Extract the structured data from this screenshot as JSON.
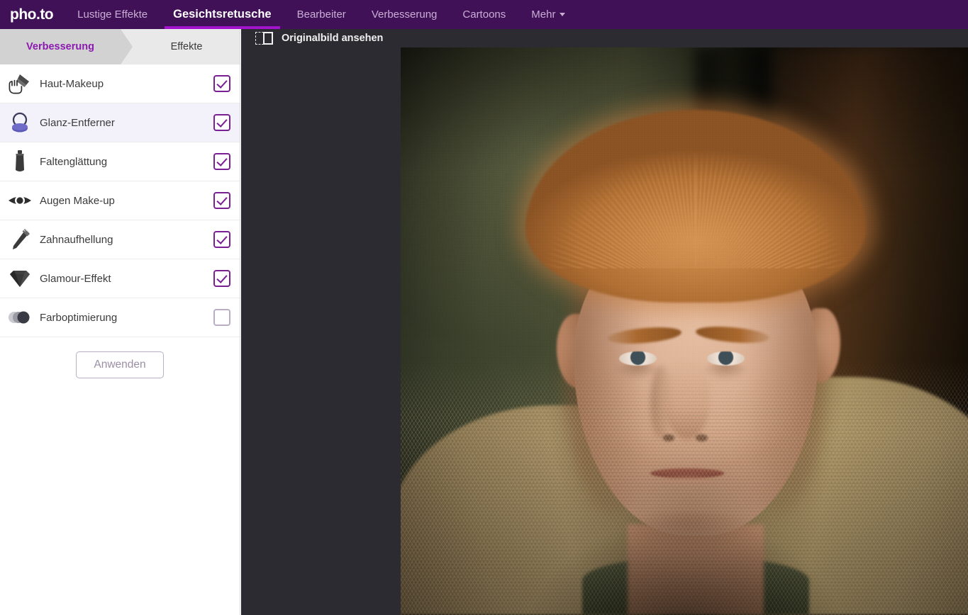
{
  "topnav": {
    "logo": "pho.to",
    "links": [
      {
        "label": "Lustige Effekte",
        "active": false
      },
      {
        "label": "Gesichtsretusche",
        "active": true
      },
      {
        "label": "Bearbeiter",
        "active": false
      },
      {
        "label": "Verbesserung",
        "active": false
      },
      {
        "label": "Cartoons",
        "active": false
      },
      {
        "label": "Mehr",
        "active": false,
        "has_caret": true
      }
    ],
    "background_color": "#411158",
    "accent_color": "#a114cc"
  },
  "sidebar": {
    "tabs": [
      {
        "label": "Verbesserung",
        "active": true
      },
      {
        "label": "Effekte",
        "active": false
      }
    ],
    "options": [
      {
        "label": "Haut-Makeup",
        "icon": "makeup-brush-icon",
        "checked": true,
        "highlighted": false,
        "cursor": true
      },
      {
        "label": "Glanz-Entferner",
        "icon": "powder-puff-icon",
        "checked": true,
        "highlighted": true,
        "cursor": false
      },
      {
        "label": "Faltenglättung",
        "icon": "cream-tube-icon",
        "checked": true,
        "highlighted": false,
        "cursor": false
      },
      {
        "label": "Augen Make-up",
        "icon": "eye-icon",
        "checked": true,
        "highlighted": false,
        "cursor": false
      },
      {
        "label": "Zahnaufhellung",
        "icon": "toothbrush-icon",
        "checked": true,
        "highlighted": false,
        "cursor": false
      },
      {
        "label": "Glamour-Effekt",
        "icon": "diamond-icon",
        "checked": true,
        "highlighted": false,
        "cursor": false
      },
      {
        "label": "Farboptimierung",
        "icon": "color-circles-icon",
        "checked": false,
        "highlighted": false,
        "cursor": false
      }
    ],
    "apply_button": "Anwenden",
    "checkbox_color": "#7b1f94",
    "checkbox_off_color": "#b9aec4",
    "highlight_color": "#f3f2fb"
  },
  "workspace": {
    "compare_label": "Originalbild ansehen",
    "compare_icon": "compare-before-after-icon",
    "background_color": "#2b2b31",
    "photo_alt": "Portrait eines rothaarigen Mannes in Tweedjacke"
  }
}
